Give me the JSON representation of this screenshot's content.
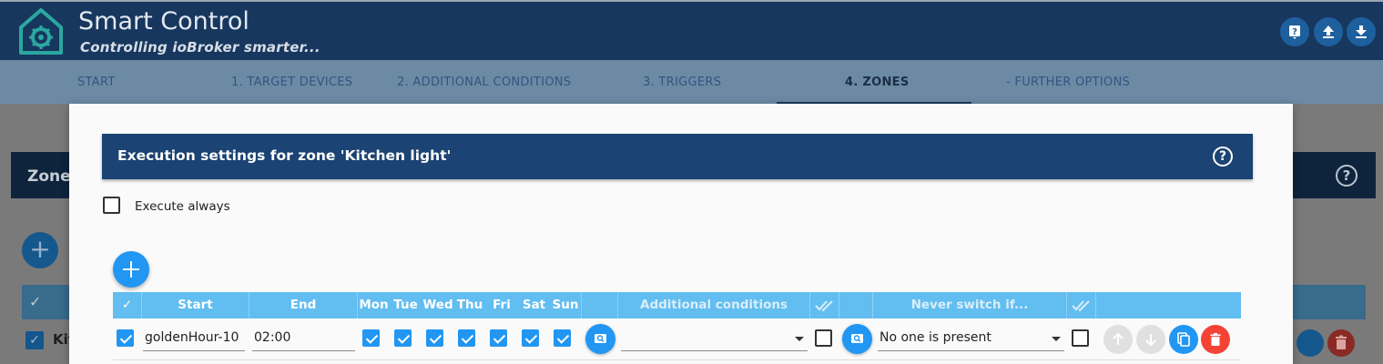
{
  "app": {
    "title": "Smart Control",
    "subtitle": "Controlling ioBroker smarter..."
  },
  "header_buttons": [
    {
      "icon": "help-icon"
    },
    {
      "icon": "upload-icon"
    },
    {
      "icon": "download-icon"
    }
  ],
  "tabs": [
    {
      "label": "START"
    },
    {
      "label": "1. TARGET DEVICES"
    },
    {
      "label": "2. ADDITIONAL CONDITIONS"
    },
    {
      "label": "3. TRIGGERS"
    },
    {
      "label": "4. ZONES",
      "active": true
    },
    {
      "label": "- FURTHER OPTIONS"
    }
  ],
  "background": {
    "zone_title": "Zone",
    "row_text": "Kit"
  },
  "dialog": {
    "title": "Execution settings for zone 'Kitchen light'",
    "execute_always_label": "Execute always",
    "execute_always_checked": false,
    "table": {
      "headers": {
        "check": "✓",
        "start": "Start",
        "end": "End",
        "mon": "Mon",
        "tue": "Tue",
        "wed": "Wed",
        "thu": "Thu",
        "fri": "Fri",
        "sat": "Sat",
        "sun": "Sun",
        "additional_conditions": "Additional conditions",
        "never_switch_if": "Never switch if..."
      },
      "rows": [
        {
          "active": true,
          "start": "goldenHour-10",
          "end": "02:00",
          "days": [
            true,
            true,
            true,
            true,
            true,
            true,
            true
          ],
          "additional_conditions": "",
          "additional_all": false,
          "never_switch_if": "No one is present",
          "never_all": false
        }
      ]
    }
  },
  "colors": {
    "header_bg": "#17375e",
    "accent": "#2196f3",
    "table_header": "#62bdf0",
    "delete": "#f44336",
    "dialog_title_bg": "#1b4373"
  }
}
